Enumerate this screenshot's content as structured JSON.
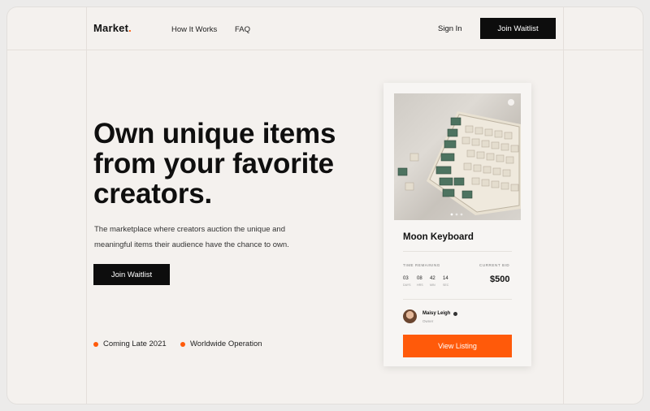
{
  "brand": {
    "name": "Market",
    "dot": ".",
    "accent": "#ff5a0a"
  },
  "nav": {
    "links": [
      "How It Works",
      "FAQ"
    ],
    "sign_in": "Sign In",
    "join": "Join Waitlist"
  },
  "hero": {
    "headline": "Own unique items from your favorite creators.",
    "subtext": "The marketplace where creators auction the unique and meaningful items their audience have the chance to own.",
    "cta": "Join Waitlist"
  },
  "features": [
    "Coming Late 2021",
    "Worldwide Operation"
  ],
  "listing": {
    "title": "Moon Keyboard",
    "image_icon": "keyboard-photo",
    "time_label": "TIME REMAINING",
    "countdown": [
      {
        "value": "03",
        "unit": "DAYS"
      },
      {
        "value": "08",
        "unit": "HRS"
      },
      {
        "value": "42",
        "unit": "MIN"
      },
      {
        "value": "14",
        "unit": "SEC"
      }
    ],
    "bid_label": "CURRENT BID",
    "bid": "$500",
    "owner": {
      "name": "Maisy Leigh",
      "role": "Owner"
    },
    "cta": "View Listing"
  }
}
